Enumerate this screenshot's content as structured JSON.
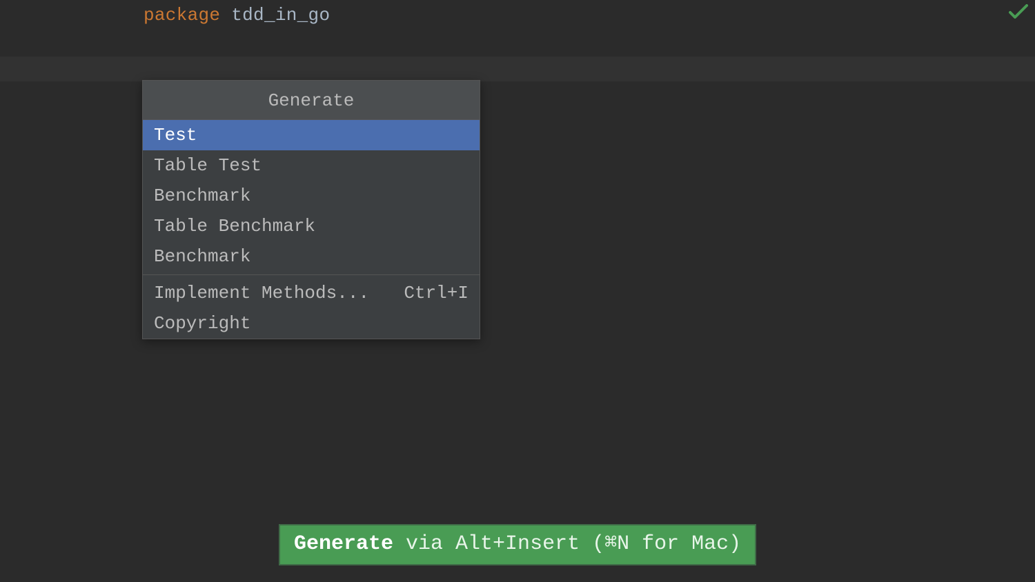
{
  "code": {
    "keyword": "package",
    "identifier": "tdd_in_go"
  },
  "popup": {
    "title": "Generate",
    "group1": [
      {
        "label": "Test",
        "shortcut": "",
        "selected": true
      },
      {
        "label": "Table Test",
        "shortcut": "",
        "selected": false
      },
      {
        "label": "Benchmark",
        "shortcut": "",
        "selected": false
      },
      {
        "label": "Table Benchmark",
        "shortcut": "",
        "selected": false
      },
      {
        "label": "Benchmark",
        "shortcut": "",
        "selected": false
      }
    ],
    "group2": [
      {
        "label": "Implement Methods...",
        "shortcut": "Ctrl+I",
        "selected": false
      },
      {
        "label": "Copyright",
        "shortcut": "",
        "selected": false
      }
    ]
  },
  "hint": {
    "strong": "Generate",
    "rest": " via Alt+Insert (⌘N for Mac)"
  },
  "icons": {
    "status_ok": "checkmark-icon"
  }
}
